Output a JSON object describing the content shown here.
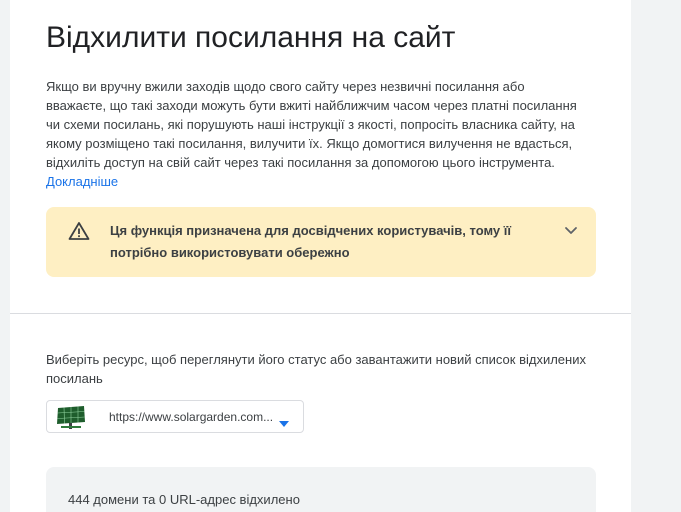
{
  "header": {
    "title": "Відхилити посилання на сайт"
  },
  "intro": {
    "text": "Якщо ви вручну вжили заходів щодо свого сайту через незвичні посилання або вважаєте, що такі заходи можуть бути вжиті найближчим часом через платні посилання чи схеми посилань, які порушують наші інструкції з якості, попросіть власника сайту, на якому розміщено такі посилання, вилучити їх. Якщо домогтися вилучення не вдасться, відхиліть доступ на свій сайт через такі посилання за допомогою цього інструмента.",
    "learn_more": "Докладніше"
  },
  "warning": {
    "icon": "warning-triangle-icon",
    "text": "Ця функція призначена для досвідчених користувачів, тому її потрібно використовувати обережно",
    "expand_icon": "chevron-down-icon"
  },
  "resource": {
    "label": "Виберіть ресурс, щоб переглянути його статус або завантажити новий список відхилених посилань",
    "selected_url": "https://www.solargarden.com...",
    "thumbnail": "solar-panel-thumbnail"
  },
  "summary": {
    "text": "444 домени та 0 URL-адрес відхилено"
  },
  "colors": {
    "link": "#1a73e8",
    "warning_bg": "#feefc3",
    "dropdown_caret": "#1a73e8"
  }
}
